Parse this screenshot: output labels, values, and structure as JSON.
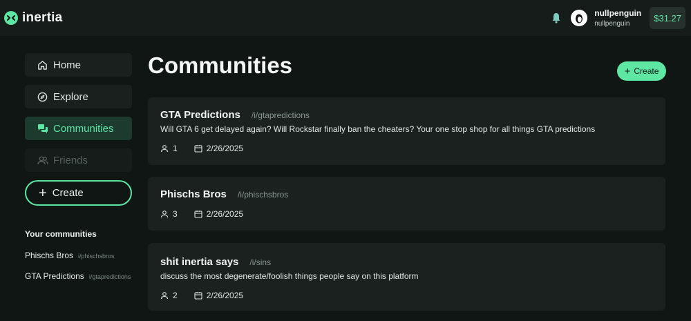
{
  "brand": {
    "name": "inertia",
    "accent": "#5ee6a3"
  },
  "header": {
    "user_name": "nullpenguin",
    "user_handle": "nullpenguin",
    "balance": "$31.27"
  },
  "sidebar": {
    "nav": [
      {
        "label": "Home",
        "icon": "home-icon"
      },
      {
        "label": "Explore",
        "icon": "compass-icon"
      },
      {
        "label": "Communities",
        "icon": "chat-icon"
      },
      {
        "label": "Friends",
        "icon": "users-icon"
      }
    ],
    "create_label": "Create",
    "your_communities_title": "Your communities",
    "your_communities": [
      {
        "name": "Phischs Bros",
        "handle": "i/phischsbros"
      },
      {
        "name": "GTA Predictions",
        "handle": "i/gtapredictions"
      }
    ]
  },
  "main": {
    "title": "Communities",
    "create_label": "Create",
    "communities": [
      {
        "name": "GTA Predictions",
        "handle": "/i/gtapredictions",
        "description": "Will GTA 6 get delayed again? Will Rockstar finally ban the cheaters? Your one stop shop for all things GTA predictions",
        "members": "1",
        "date": "2/26/2025"
      },
      {
        "name": "Phischs Bros",
        "handle": "/i/phischsbros",
        "description": "",
        "members": "3",
        "date": "2/26/2025"
      },
      {
        "name": "shit inertia says",
        "handle": "/i/sins",
        "description": "discuss the most degenerate/foolish things people say on this platform",
        "members": "2",
        "date": "2/26/2025"
      }
    ]
  }
}
